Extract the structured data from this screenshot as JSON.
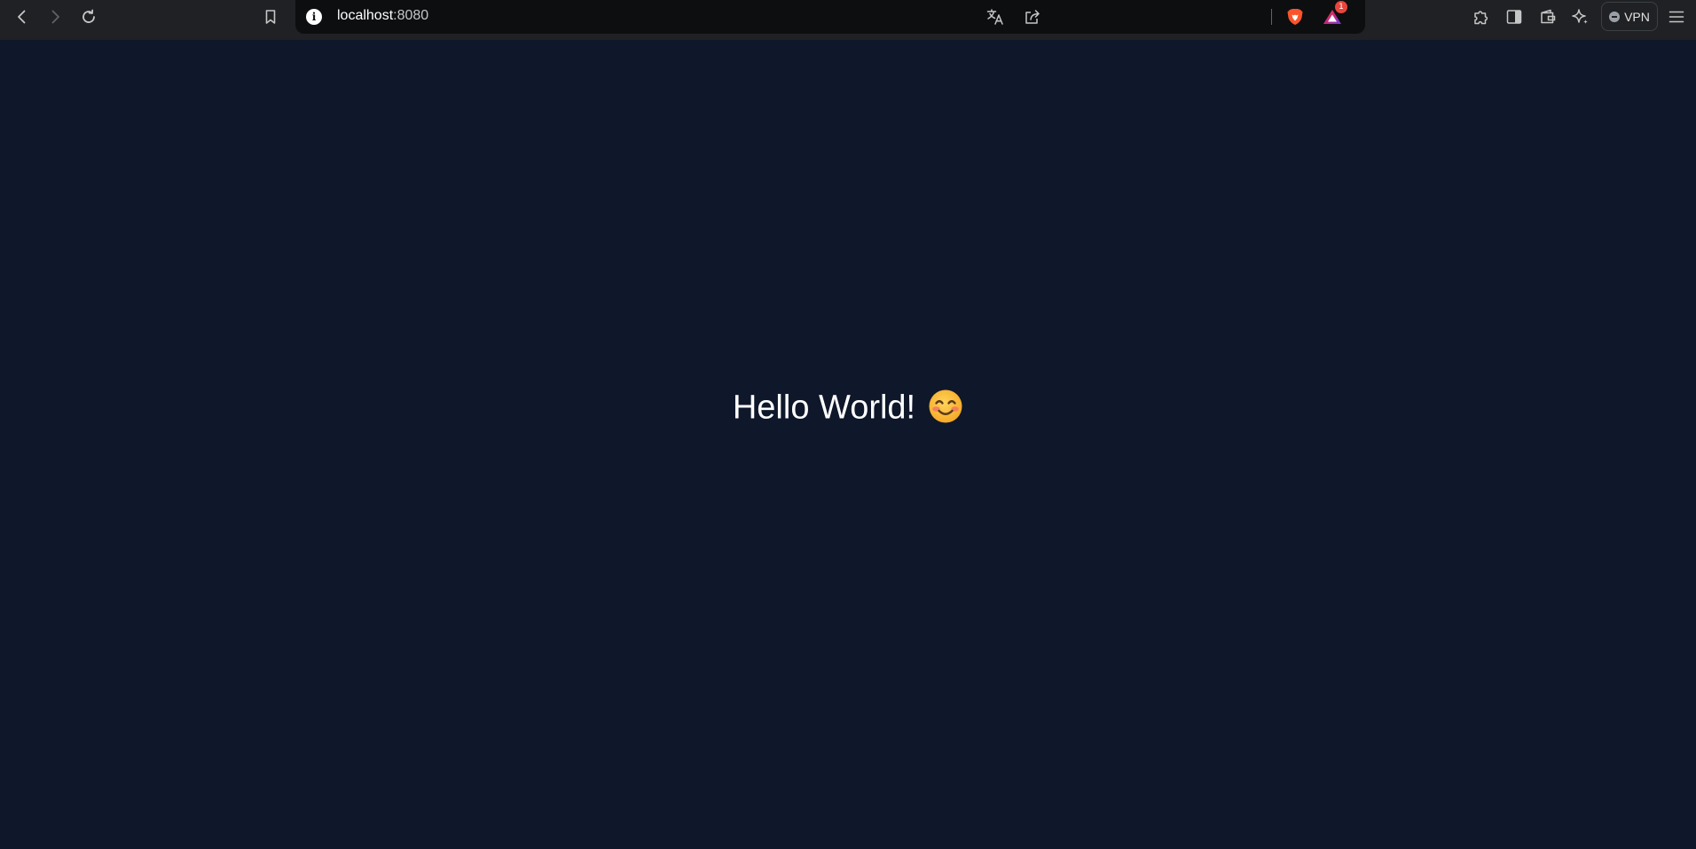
{
  "browser": {
    "url": {
      "host": "localhost",
      "port": ":8080"
    },
    "vpn_label": "VPN",
    "rewards_badge": "1",
    "accent_color": "#fb542b"
  },
  "page": {
    "greeting": "Hello World!",
    "emoji": "smiling-face-with-smiling-eyes",
    "background_color": "#0f172a"
  }
}
